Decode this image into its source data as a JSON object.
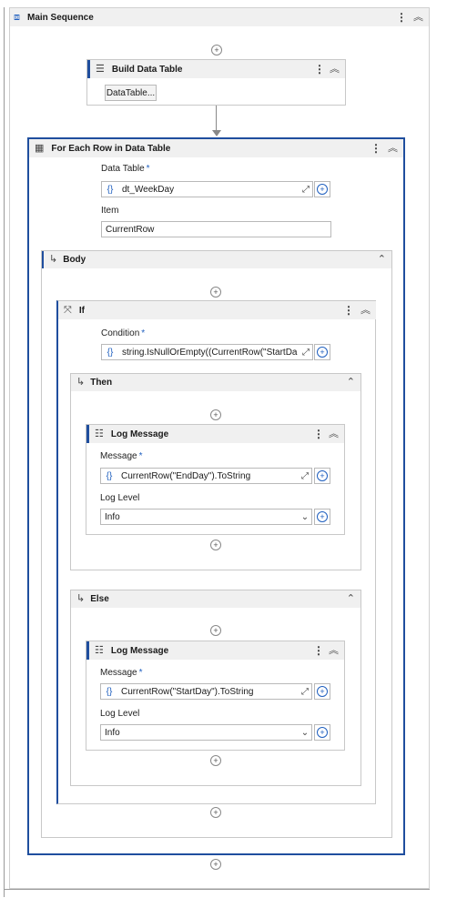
{
  "main_sequence": {
    "title": "Main Sequence"
  },
  "build_data_table": {
    "title": "Build Data Table",
    "button": "DataTable..."
  },
  "for_each": {
    "title": "For Each Row in Data Table",
    "data_table_label": "Data Table",
    "data_table_value": "dt_WeekDay",
    "item_label": "Item",
    "item_value": "CurrentRow",
    "body_label": "Body"
  },
  "if": {
    "title": "If",
    "condition_label": "Condition",
    "condition_value": "string.IsNullOrEmpty((CurrentRow(\"StartDa",
    "then_label": "Then",
    "else_label": "Else"
  },
  "log_then": {
    "title": "Log Message",
    "message_label": "Message",
    "message_value": "CurrentRow(\"EndDay\").ToString",
    "level_label": "Log Level",
    "level_value": "Info"
  },
  "log_else": {
    "title": "Log Message",
    "message_label": "Message",
    "message_value": "CurrentRow(\"StartDay\").ToString",
    "level_label": "Log Level",
    "level_value": "Info"
  },
  "symbols": {
    "required": "*",
    "curly": "{}",
    "plus": "+",
    "dots": "⋮",
    "collapse": "⌃",
    "collapse_double": "︽",
    "chevron_down": "⌄",
    "expand": "⤢",
    "body_arrow": "↳"
  },
  "colors": {
    "selection_border": "#1f4e9e",
    "header_bg": "#f0f0f0",
    "accent": "#1f5fbf"
  }
}
